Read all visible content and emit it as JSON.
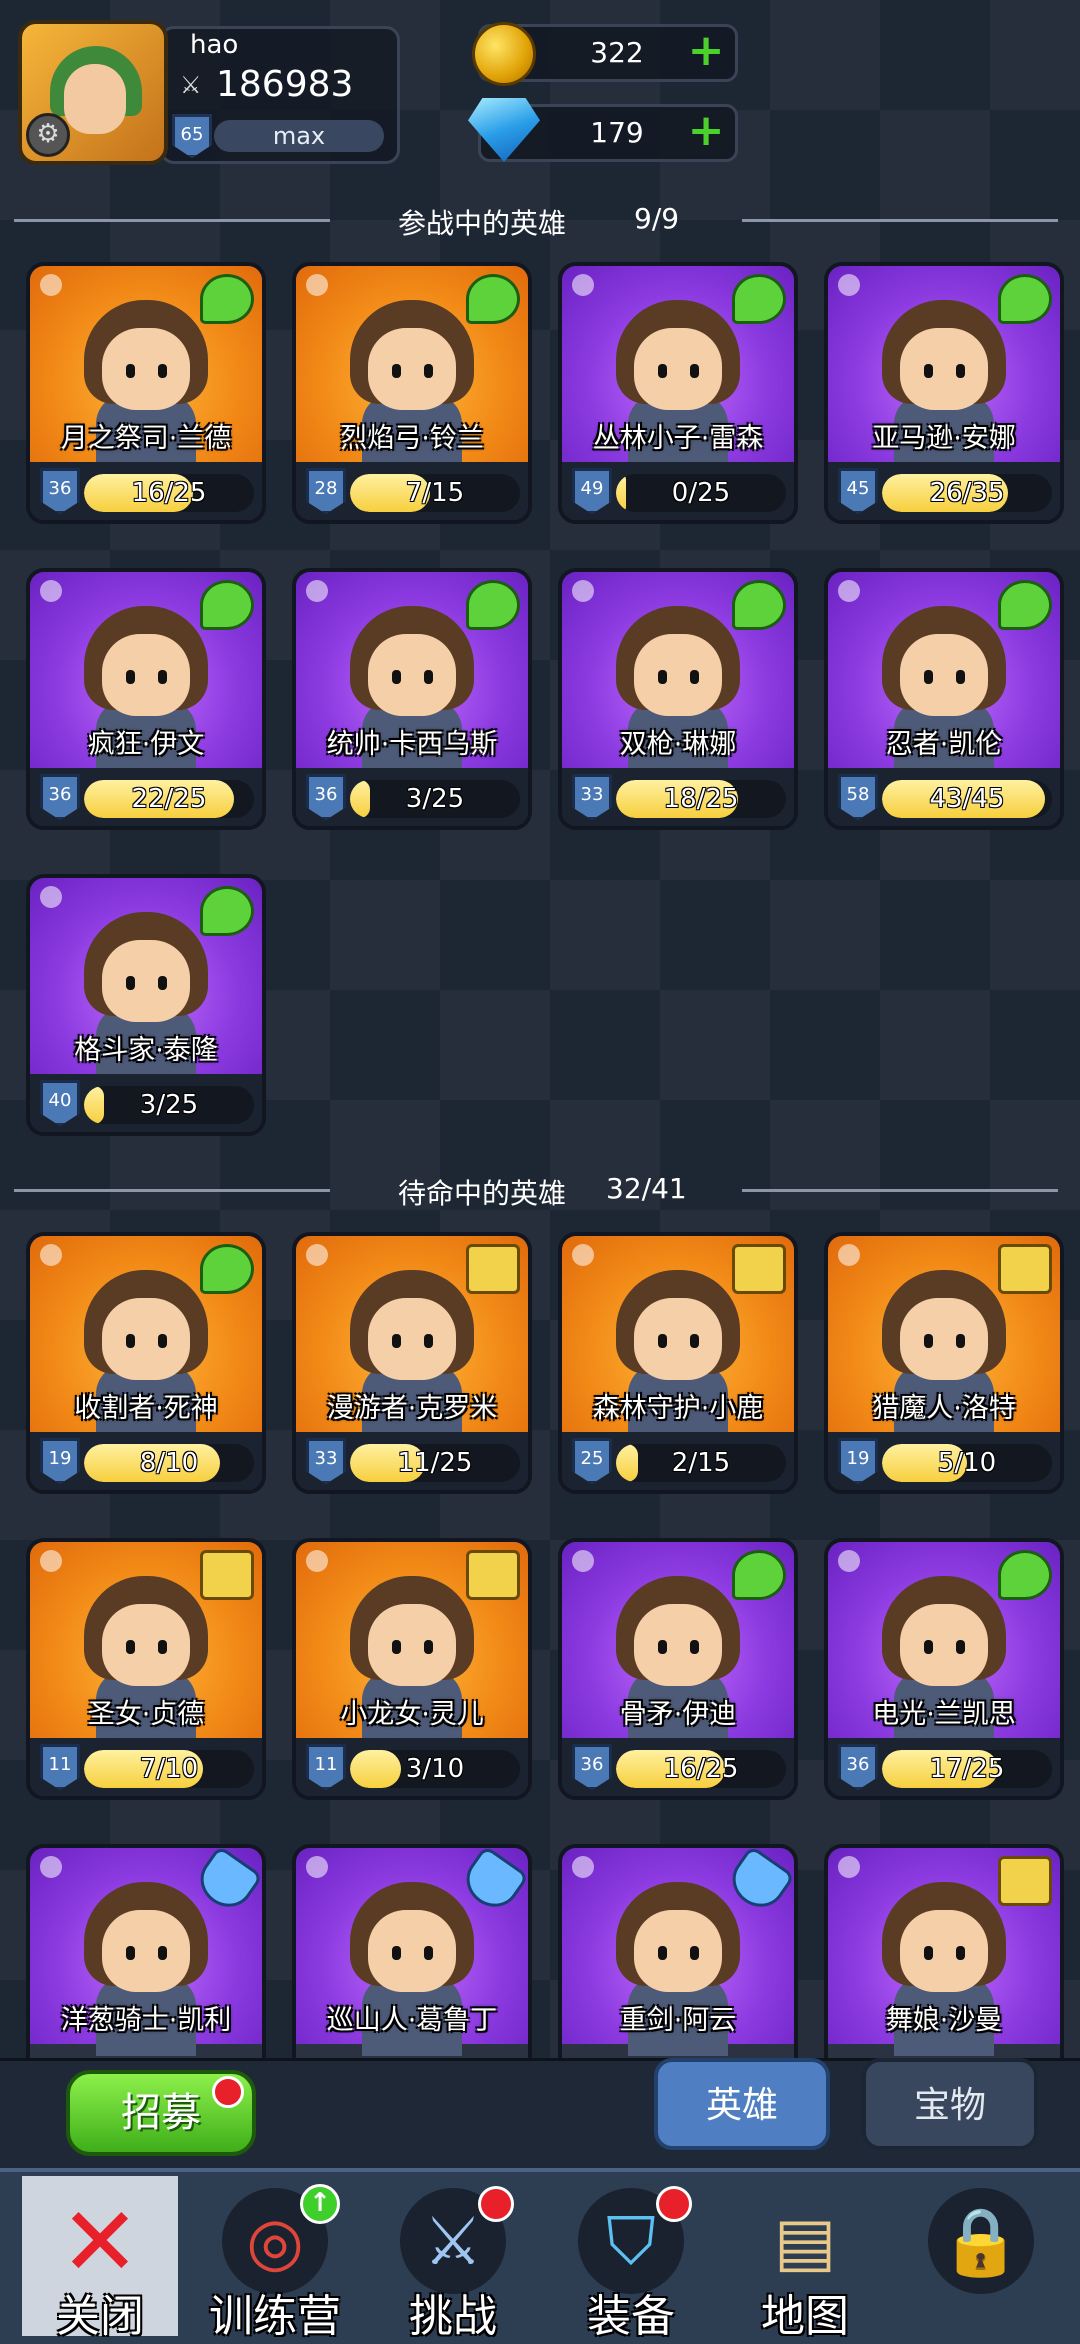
{
  "player": {
    "name": "hao",
    "power": "186983",
    "level": "65",
    "exp_label": "max"
  },
  "currency": {
    "gold": "322",
    "gems": "179"
  },
  "sections": {
    "active_title": "参战中的英雄",
    "active_count": "9/9",
    "reserve_title": "待命中的英雄",
    "reserve_count": "32/41"
  },
  "active_heroes": [
    {
      "name": "月之祭司·兰德",
      "level": "36",
      "fragments": "16/25",
      "progress": 0.64,
      "rarity": "orange",
      "type": "wing"
    },
    {
      "name": "烈焰弓·铃兰",
      "level": "28",
      "fragments": "7/15",
      "progress": 0.47,
      "rarity": "orange",
      "type": "wing"
    },
    {
      "name": "丛林小子·雷森",
      "level": "49",
      "fragments": "0/25",
      "progress": 0.0,
      "rarity": "purple",
      "type": "wing"
    },
    {
      "name": "亚马逊·安娜",
      "level": "45",
      "fragments": "26/35",
      "progress": 0.74,
      "rarity": "purple",
      "type": "wing"
    },
    {
      "name": "疯狂·伊文",
      "level": "36",
      "fragments": "22/25",
      "progress": 0.88,
      "rarity": "purple",
      "type": "wing"
    },
    {
      "name": "统帅·卡西乌斯",
      "level": "36",
      "fragments": "3/25",
      "progress": 0.12,
      "rarity": "purple",
      "type": "wing"
    },
    {
      "name": "双枪·琳娜",
      "level": "33",
      "fragments": "18/25",
      "progress": 0.72,
      "rarity": "purple",
      "type": "wing"
    },
    {
      "name": "忍者·凯伦",
      "level": "58",
      "fragments": "43/45",
      "progress": 0.96,
      "rarity": "purple",
      "type": "wing"
    },
    {
      "name": "格斗家·泰隆",
      "level": "40",
      "fragments": "3/25",
      "progress": 0.12,
      "rarity": "purple",
      "type": "wing"
    }
  ],
  "reserve_heroes": [
    {
      "name": "收割者·死神",
      "level": "19",
      "fragments": "8/10",
      "progress": 0.8,
      "rarity": "orange",
      "type": "wing"
    },
    {
      "name": "漫游者·克罗米",
      "level": "33",
      "fragments": "11/25",
      "progress": 0.44,
      "rarity": "orange",
      "type": "book"
    },
    {
      "name": "森林守护·小鹿",
      "level": "25",
      "fragments": "2/15",
      "progress": 0.13,
      "rarity": "orange",
      "type": "book"
    },
    {
      "name": "猎魔人·洛特",
      "level": "19",
      "fragments": "5/10",
      "progress": 0.5,
      "rarity": "orange",
      "type": "book"
    },
    {
      "name": "圣女·贞德",
      "level": "11",
      "fragments": "7/10",
      "progress": 0.7,
      "rarity": "orange",
      "type": "book"
    },
    {
      "name": "小龙女·灵儿",
      "level": "11",
      "fragments": "3/10",
      "progress": 0.3,
      "rarity": "orange",
      "type": "book"
    },
    {
      "name": "骨矛·伊迪",
      "level": "36",
      "fragments": "16/25",
      "progress": 0.64,
      "rarity": "purple",
      "type": "wing"
    },
    {
      "name": "电光·兰凯思",
      "level": "36",
      "fragments": "17/25",
      "progress": 0.68,
      "rarity": "purple",
      "type": "wing"
    },
    {
      "name": "洋葱骑士·凯利",
      "level": "",
      "fragments": "",
      "progress": 0,
      "rarity": "purple",
      "type": "potion"
    },
    {
      "name": "巡山人·葛鲁丁",
      "level": "",
      "fragments": "",
      "progress": 0,
      "rarity": "purple",
      "type": "potion"
    },
    {
      "name": "重剑·阿云",
      "level": "",
      "fragments": "",
      "progress": 0,
      "rarity": "purple",
      "type": "potion"
    },
    {
      "name": "舞娘·沙曼",
      "level": "",
      "fragments": "",
      "progress": 0,
      "rarity": "purple",
      "type": "book"
    }
  ],
  "actions": {
    "recruit": "招募",
    "tab_heroes": "英雄",
    "tab_treasure": "宝物"
  },
  "nav": [
    {
      "label": "关闭",
      "icon": "close-icon"
    },
    {
      "label": "训练营",
      "icon": "target-icon"
    },
    {
      "label": "挑战",
      "icon": "sword-icon"
    },
    {
      "label": "装备",
      "icon": "teapot-icon"
    },
    {
      "label": "地图",
      "icon": "map-icon"
    },
    {
      "label": "",
      "icon": "lock-icon"
    }
  ],
  "colors": {
    "orange": "#f28a17",
    "purple": "#8b3ae0",
    "accent_green": "#4bd12b",
    "tab_active": "#4f7fc2"
  }
}
